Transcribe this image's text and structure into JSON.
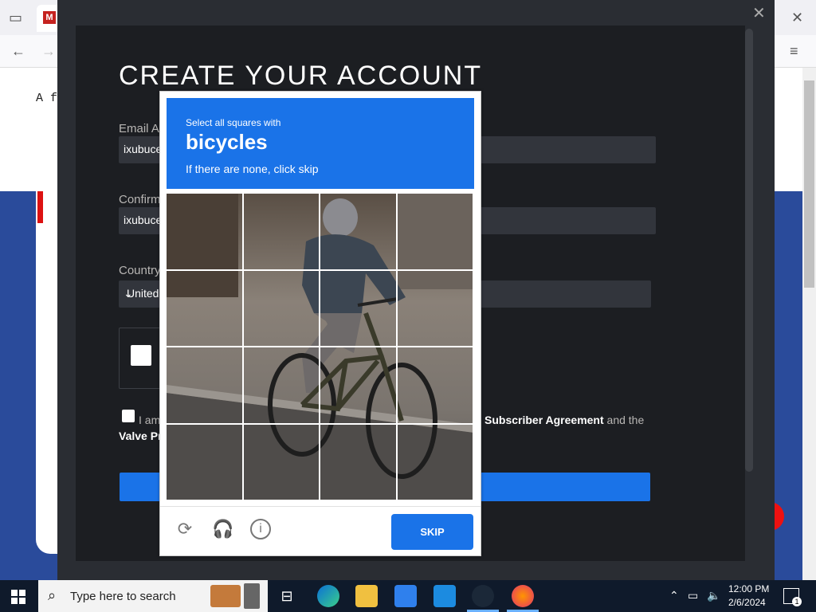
{
  "browser": {
    "page_snippet": "A fi",
    "back_icon": "arrow-left-icon",
    "forward_icon": "arrow-right-icon",
    "menu_icon": "hamburger-icon",
    "close_icon": "close-icon"
  },
  "modal": {
    "title": "CREATE YOUR ACCOUNT",
    "email_label": "Email Ac",
    "email_value": "ixubuce",
    "confirm_label": "Confirm",
    "confirm_value": "ixubuce",
    "country_label": "Country",
    "country_value": "United",
    "agree_prefix": "I am",
    "agree_suffix_link": "Subscriber Agreement",
    "agree_suffix_rest": " and the",
    "valve_text": "Valve Pr"
  },
  "captcha": {
    "instruction": "Select all squares with",
    "target": "bicycles",
    "hint": "If there are none, click skip",
    "skip_label": "SKIP",
    "refresh_icon": "refresh-icon",
    "audio_icon": "headphones-icon",
    "info_icon": "info-icon"
  },
  "taskbar": {
    "search_placeholder": "Type here to search",
    "time": "12:00 PM",
    "date": "2/6/2024",
    "notification_count": "1"
  },
  "colors": {
    "accent": "#1a73e8",
    "modal_bg": "#1c1e22",
    "taskbar_bg": "#0f1a2b"
  }
}
